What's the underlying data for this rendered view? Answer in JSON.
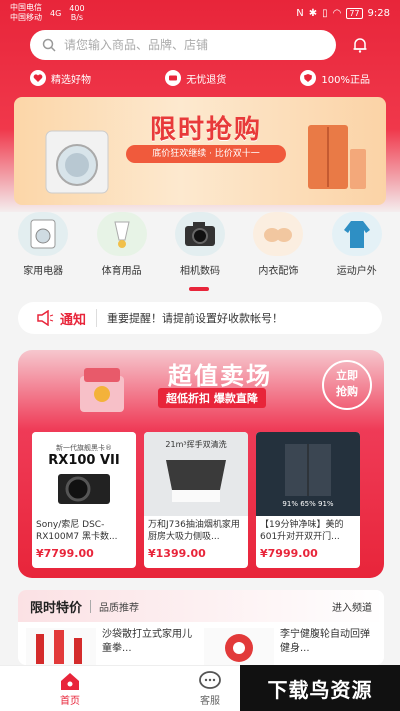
{
  "status_bar": {
    "carrier_1": "中国电信",
    "carrier_2": "中国移动",
    "network": "4G",
    "speed_value": "400",
    "speed_unit": "B/s",
    "battery": "77",
    "time": "9:28"
  },
  "search": {
    "placeholder": "请您输入商品、品牌、店铺"
  },
  "features": [
    {
      "label": "精选好物",
      "icon": "heart-icon"
    },
    {
      "label": "无忧退货",
      "icon": "card-icon"
    },
    {
      "label": "100%正品",
      "icon": "shield-icon"
    }
  ],
  "banner": {
    "title": "限时抢购",
    "subtitle": "底价狂欢继续 · 比价双十一"
  },
  "categories": [
    {
      "label": "家用电器",
      "icon": "washing-machine-icon"
    },
    {
      "label": "体育用品",
      "icon": "shuttlecock-icon"
    },
    {
      "label": "相机数码",
      "icon": "camera-icon"
    },
    {
      "label": "内衣配饰",
      "icon": "lingerie-icon"
    },
    {
      "label": "运动户外",
      "icon": "jacket-icon"
    }
  ],
  "notice": {
    "title": "通知",
    "text": "重要提醒！请提前设置好收款帐号！"
  },
  "deal": {
    "title": "超值卖场",
    "subtitle": "超低折扣 爆款直降",
    "go_line1": "立即",
    "go_line2": "抢购",
    "products": [
      {
        "name": "Sony/索尼 DSC-RX100M7 黑卡数...",
        "price": "¥7799.00",
        "badge": "RX100 VII",
        "badge_top": "新一代旗舰黑卡®"
      },
      {
        "name": "万和J736抽油烟机家用厨房大吸力侧吸...",
        "price": "¥1399.00",
        "badge": "21m³挥手双清洗"
      },
      {
        "name": "【19分钟净味】美的601升对开双开门...",
        "price": "¥7999.00",
        "badge": "91% 65% 91%"
      }
    ]
  },
  "flash": {
    "title": "限时特价",
    "subtitle": "品质推荐",
    "enter": "进入频道",
    "items": [
      {
        "name": "沙袋散打立式家用儿童拳..."
      },
      {
        "name": "李宁健腹轮自动回弹健身..."
      }
    ]
  },
  "tabbar": [
    {
      "label": "首页",
      "icon": "home-icon"
    },
    {
      "label": "客服",
      "icon": "chat-icon"
    }
  ],
  "watermark": "下载鸟资源",
  "colors": {
    "brand_red": "#e8253a",
    "banner_orange": "#fcd6a8"
  }
}
